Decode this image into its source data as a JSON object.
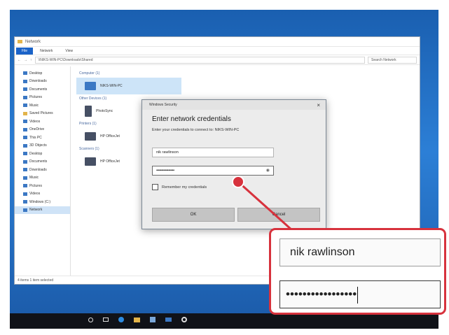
{
  "explorer": {
    "title": "Network",
    "ribbon_tabs": [
      "File",
      "Network",
      "View"
    ],
    "address_path": "\\\\NIKS-WIN-PC\\Downloads\\Shared",
    "search_placeholder": "Search Network",
    "nav_items": [
      {
        "label": "Desktop",
        "icon": "desktop-icon"
      },
      {
        "label": "Downloads",
        "icon": "download-icon"
      },
      {
        "label": "Documents",
        "icon": "document-icon"
      },
      {
        "label": "Pictures",
        "icon": "picture-icon"
      },
      {
        "label": "Music",
        "icon": "music-icon"
      },
      {
        "label": "Saved Pictures",
        "icon": "folder-icon"
      },
      {
        "label": "Videos",
        "icon": "video-icon"
      },
      {
        "label": "OneDrive",
        "icon": "cloud-icon"
      },
      {
        "label": "This PC",
        "icon": "computer-icon"
      },
      {
        "label": "3D Objects",
        "icon": "cube-icon"
      },
      {
        "label": "Desktop",
        "icon": "desktop-icon"
      },
      {
        "label": "Documents",
        "icon": "document-icon"
      },
      {
        "label": "Downloads",
        "icon": "download-icon"
      },
      {
        "label": "Music",
        "icon": "music-icon"
      },
      {
        "label": "Pictures",
        "icon": "picture-icon"
      },
      {
        "label": "Videos",
        "icon": "video-icon"
      },
      {
        "label": "Windows (C:)",
        "icon": "drive-icon"
      },
      {
        "label": "Network",
        "icon": "network-icon"
      }
    ],
    "groups": [
      {
        "title": "Computer (1)",
        "items": [
          "NIKS-WIN-PC"
        ]
      },
      {
        "title": "Other Devices (1)",
        "items": [
          "PhotoSync"
        ]
      },
      {
        "title": "Printers (1)",
        "items": [
          "HP OfficeJet"
        ]
      },
      {
        "title": "Scanners (1)",
        "items": [
          "HP OfficeJet"
        ]
      }
    ],
    "status_text": "4 items    1 item selected"
  },
  "dialog": {
    "window_title": "Windows Security",
    "close_label": "×",
    "heading": "Enter network credentials",
    "subtitle": "Enter your credentials to connect to: NIKS-WIN-PC",
    "username_value": "nik rawlinson",
    "password_value": "••••••••••••••••••",
    "reveal_glyph": "◉",
    "remember_label": "Remember my credentials",
    "ok_label": "OK",
    "cancel_label": "Cancel"
  },
  "zoom": {
    "username_value": "nik rawlinson",
    "password_value": "•••••••••••••••••"
  },
  "taskbar": {
    "icons": [
      "search-icon",
      "taskview-icon",
      "edge-icon",
      "explorer-icon",
      "store-icon",
      "mail-icon",
      "settings-icon"
    ]
  },
  "colors": {
    "accent": "#1a63c8",
    "callout": "#d7323d",
    "desktop": "#2c7fd6"
  }
}
